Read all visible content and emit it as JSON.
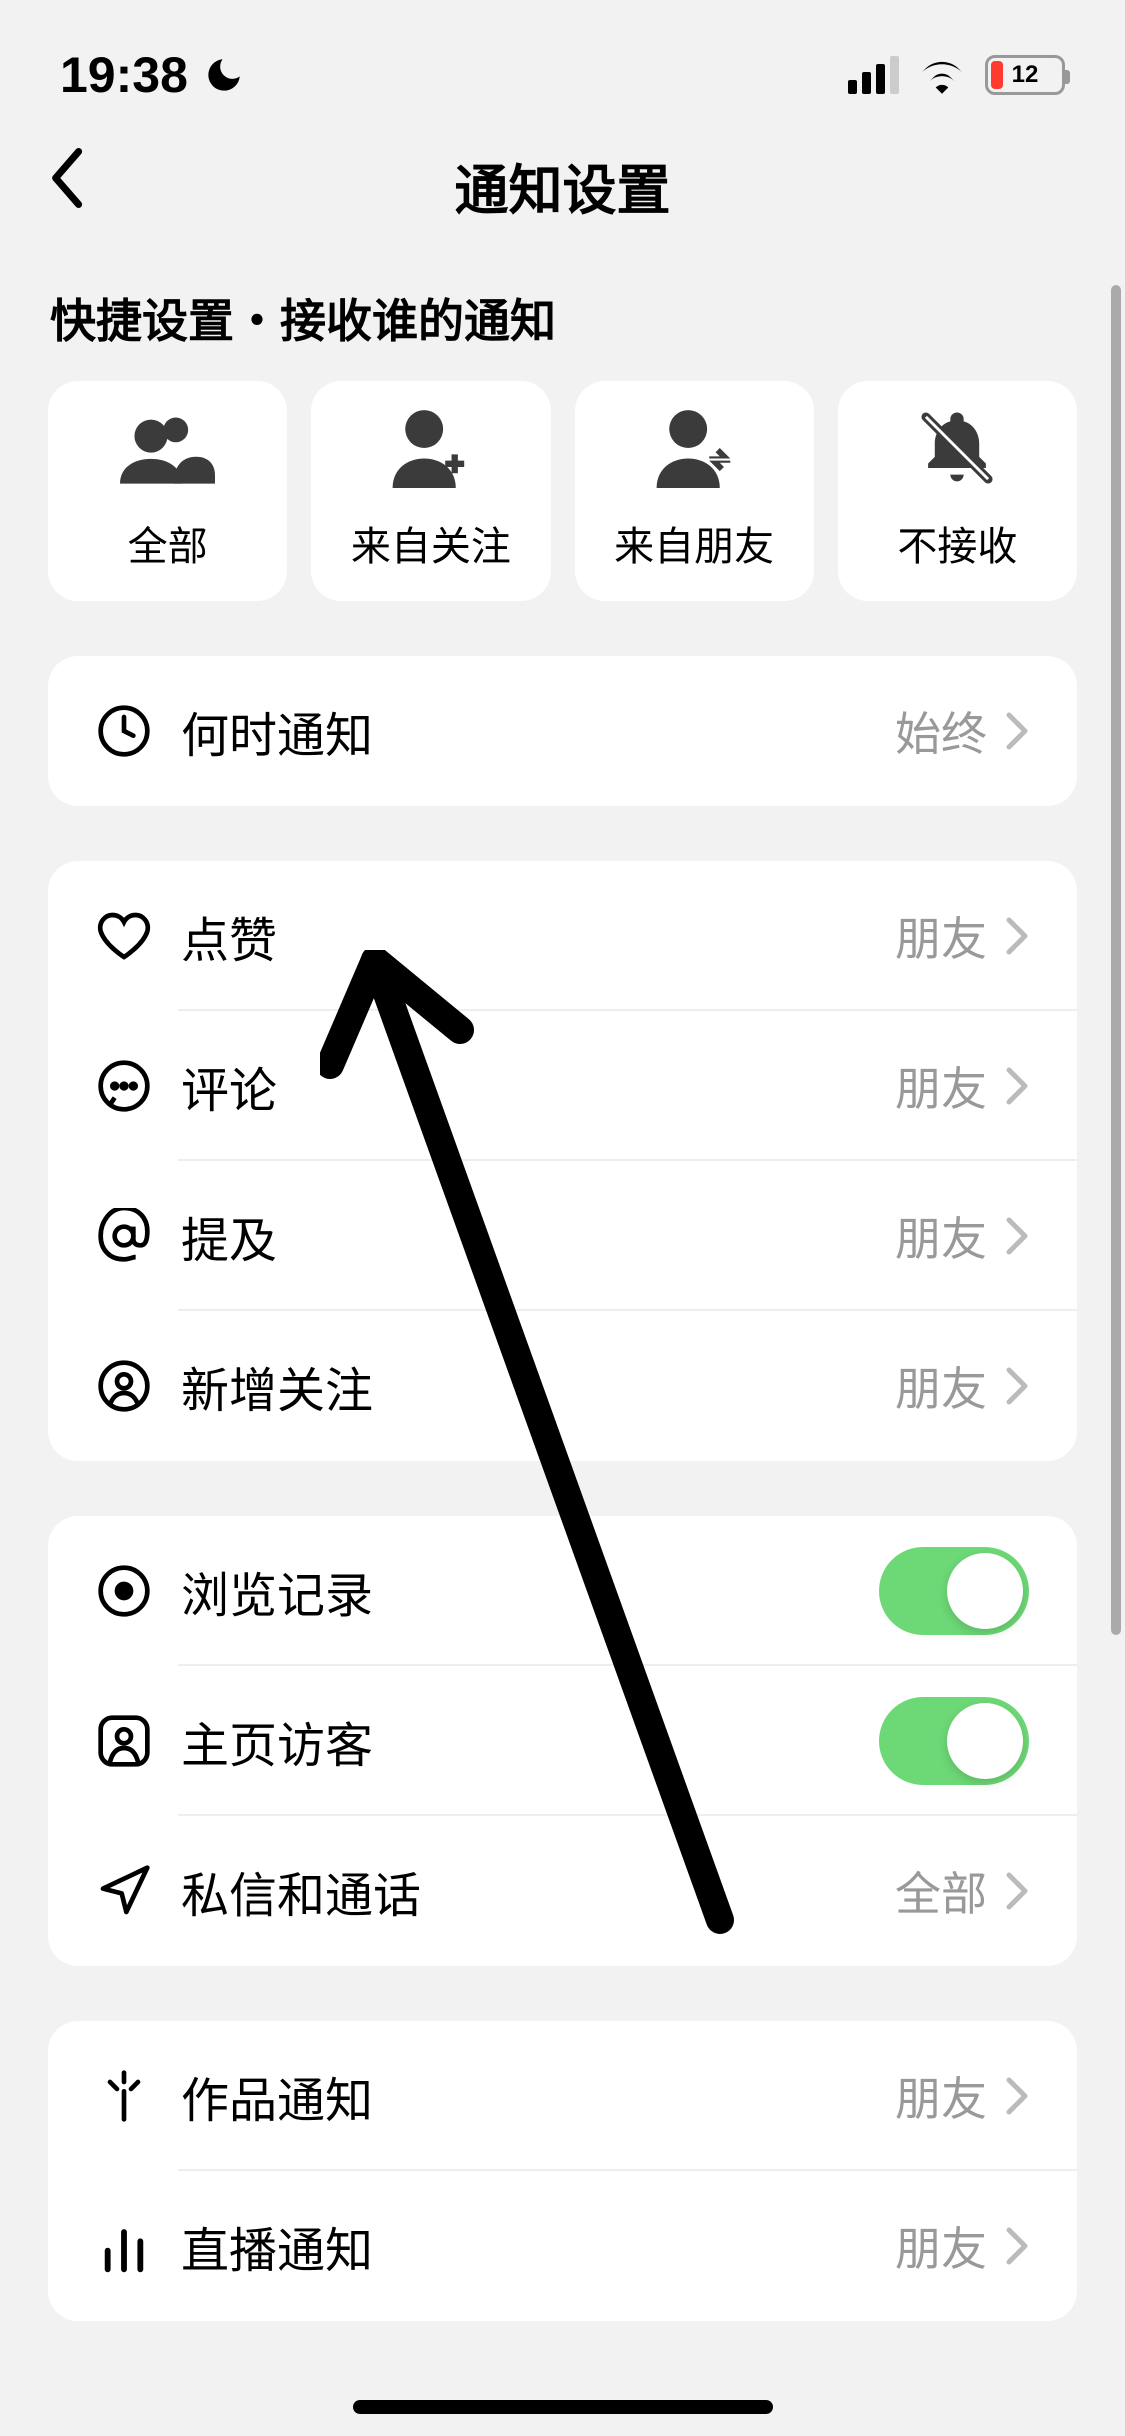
{
  "status_bar": {
    "time": "19:38",
    "battery_percent": "12"
  },
  "header": {
    "title": "通知设置"
  },
  "section_title": "快捷设置・接收谁的通知",
  "quick_options": [
    {
      "label": "全部"
    },
    {
      "label": "来自关注"
    },
    {
      "label": "来自朋友"
    },
    {
      "label": "不接收"
    }
  ],
  "group1": {
    "when_notify": {
      "label": "何时通知",
      "value": "始终"
    }
  },
  "group2": {
    "like": {
      "label": "点赞",
      "value": "朋友"
    },
    "comment": {
      "label": "评论",
      "value": "朋友"
    },
    "mention": {
      "label": "提及",
      "value": "朋友"
    },
    "follow": {
      "label": "新增关注",
      "value": "朋友"
    }
  },
  "group3": {
    "browse": {
      "label": "浏览记录"
    },
    "visitor": {
      "label": "主页访客"
    },
    "dm": {
      "label": "私信和通话",
      "value": "全部"
    }
  },
  "group4": {
    "work": {
      "label": "作品通知",
      "value": "朋友"
    },
    "live": {
      "label": "直播通知",
      "value": "朋友"
    }
  }
}
